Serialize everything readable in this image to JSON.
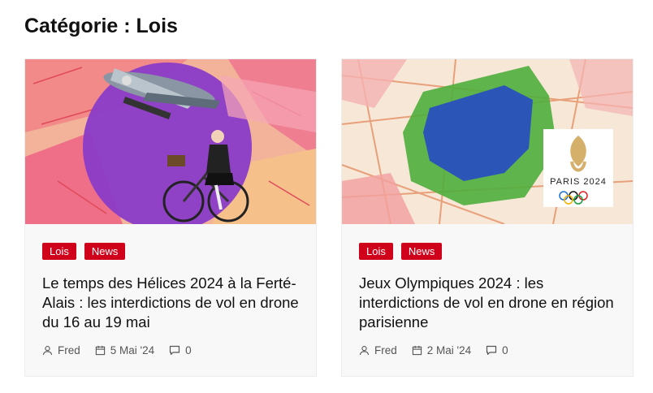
{
  "page": {
    "title": "Catégorie : Lois"
  },
  "articles": [
    {
      "badges": [
        "Lois",
        "News"
      ],
      "title": "Le temps des Hélices 2024 à la Ferté-Alais : les interdictions de vol en drone du 16 au 19 mai",
      "author": "Fred",
      "date": "5 Mai '24",
      "comments": "0",
      "image_icon": "plane-and-cyclist-illustration"
    },
    {
      "badges": [
        "Lois",
        "News"
      ],
      "title": "Jeux Olympiques 2024 : les interdictions de vol en drone en région parisienne",
      "author": "Fred",
      "date": "2 Mai '24",
      "comments": "0",
      "image_icon": "paris-2024-map",
      "logo_text": "PARIS 2024"
    }
  ],
  "colors": {
    "accent": "#d0021b",
    "text": "#111111",
    "meta": "#555555"
  }
}
